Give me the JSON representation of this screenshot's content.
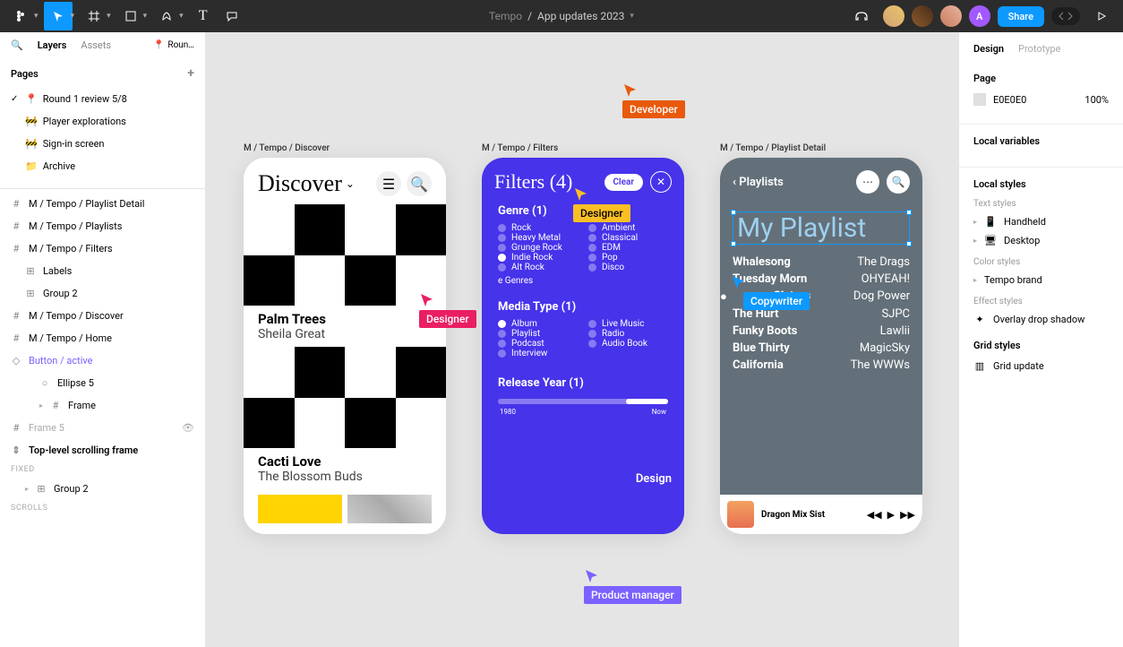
{
  "toolbar": {
    "project": "Tempo",
    "file": "App updates 2023",
    "share": "Share",
    "me_initial": "A"
  },
  "left": {
    "tabs": {
      "layers": "Layers",
      "assets": "Assets"
    },
    "page_ind": "Roun…",
    "pages_title": "Pages",
    "pages": [
      {
        "icon": "📍",
        "label": "Round 1 review 5/8",
        "active": true
      },
      {
        "icon": "🚧",
        "label": "Player explorations"
      },
      {
        "icon": "🚧",
        "label": "Sign-in screen"
      },
      {
        "icon": "📁",
        "label": "Archive"
      }
    ],
    "layers": [
      {
        "icon": "#",
        "label": "M / Tempo / Playlist Detail"
      },
      {
        "icon": "#",
        "label": "M / Tempo / Playlists"
      },
      {
        "icon": "#",
        "label": "M / Tempo / Filters"
      },
      {
        "icon": "⊞",
        "label": "Labels",
        "indent": 1
      },
      {
        "icon": "⊞",
        "label": "Group 2",
        "indent": 1
      },
      {
        "icon": "#",
        "label": "M / Tempo / Discover"
      },
      {
        "icon": "#",
        "label": "M / Tempo / Home"
      },
      {
        "icon": "◇",
        "label": "Button / active",
        "purple": true
      },
      {
        "icon": "○",
        "label": "Ellipse 5",
        "indent": 2
      },
      {
        "icon": "#",
        "label": "Frame",
        "indent": 2,
        "chev": true
      },
      {
        "icon": "#",
        "label": "Frame 5",
        "gray": true,
        "eye": true
      },
      {
        "icon": "⇕",
        "label": "Top-level scrolling frame",
        "bold": true
      }
    ],
    "fixed_label": "FIXED",
    "fixed_layer": "Group 2",
    "scrolls_label": "SCROLLS"
  },
  "right": {
    "tabs": {
      "design": "Design",
      "prototype": "Prototype"
    },
    "page_title": "Page",
    "page_color": "E0E0E0",
    "page_pct": "100%",
    "local_vars": "Local variables",
    "local_styles": "Local styles",
    "text_styles": "Text styles",
    "ts1": "Handheld",
    "ts2": "Desktop",
    "color_styles": "Color styles",
    "cs1": "Tempo brand",
    "effect_styles": "Effect styles",
    "es1": "Overlay drop shadow",
    "grid_styles": "Grid styles",
    "gs1": "Grid update"
  },
  "frames": {
    "f1": "M / Tempo / Discover",
    "f2": "M / Tempo / Filters",
    "f3": "M / Tempo / Playlist Detail"
  },
  "discover": {
    "title": "Discover",
    "t1_title": "Palm Trees",
    "t1_artist": "Sheila Great",
    "t2_title": "Cacti Love",
    "t2_artist": "The Blossom Buds"
  },
  "filters": {
    "title": "Filters (4)",
    "clear": "Clear",
    "genre": "Genre (1)",
    "genres_l": [
      "Rock",
      "Heavy Metal",
      "Grunge Rock",
      "Indie Rock",
      "Alt Rock",
      "e Genres"
    ],
    "genres_r": [
      "Ambient",
      "Classical",
      "EDM",
      "Pop",
      "Disco"
    ],
    "media": "Media Type (1)",
    "media_l": [
      "Album",
      "Playlist",
      "Podcast",
      "Interview"
    ],
    "media_r": [
      "Live Music",
      "Radio",
      "Audio Book"
    ],
    "year": "Release Year (1)",
    "design": "Design",
    "yr_min": "1980",
    "yr_max": "Now"
  },
  "playlist": {
    "back": "Playlists",
    "title": "My Playlist",
    "tracks": [
      {
        "n": "Whalesong",
        "a": "The Drags"
      },
      {
        "n": "Tuesday Morn",
        "a": "OHYEAH!"
      },
      {
        "n": "Sisters",
        "a": "Dog Power",
        "sel": true
      },
      {
        "n": "The Hurt",
        "a": "SJPC"
      },
      {
        "n": "Funky Boots",
        "a": "Lawlii"
      },
      {
        "n": "Blue Thirty",
        "a": "MagicSky"
      },
      {
        "n": "California",
        "a": "The WWWs"
      }
    ],
    "now_playing": "Dragon Mix Sist"
  },
  "cursors": {
    "developer": "Developer",
    "designer1": "Designer",
    "designer2": "Designer",
    "copywriter": "Copywriter",
    "pm": "Product manager"
  }
}
